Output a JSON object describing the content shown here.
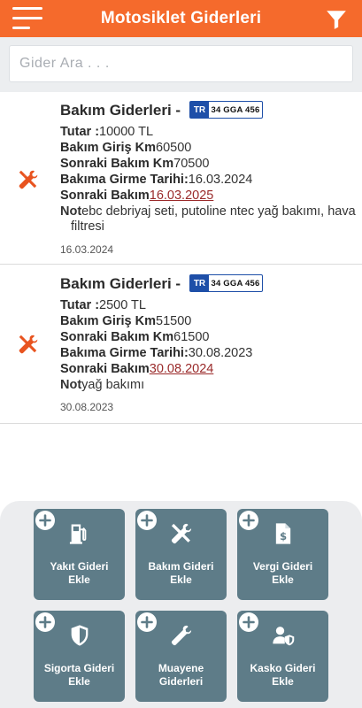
{
  "app": {
    "title": "Motosiklet Giderleri",
    "accent_color": "#f56a2c",
    "menu_icon": "hamburger-menu-icon",
    "filter_icon": "filter-icon"
  },
  "search": {
    "placeholder": "Gider Ara . . ."
  },
  "expenses": [
    {
      "title": "Bakım Giderleri -",
      "icon": "tools-icon",
      "plate": {
        "country": "TR",
        "number": "34 GGA 456"
      },
      "amount_label": "Tutar :",
      "amount": "10000 TL",
      "km_in_label": "Bakım Giriş Km",
      "km_in": "60500",
      "km_next_label": "Sonraki Bakım Km",
      "km_next": "70500",
      "date_in_label": "Bakıma Girme Tarihi:",
      "date_in": "16.03.2024",
      "next_label": "Sonraki Bakım",
      "next_date": "16.03.2025",
      "note_label": "Not",
      "note_line1": "ebc debriyaj seti, putoline ntec yağ bakımı, hava",
      "note_line2": "filtresi",
      "date": "16.03.2024"
    },
    {
      "title": "Bakım Giderleri -",
      "icon": "tools-icon",
      "plate": {
        "country": "TR",
        "number": "34 GGA 456"
      },
      "amount_label": "Tutar :",
      "amount": "2500 TL",
      "km_in_label": "Bakım Giriş Km",
      "km_in": "51500",
      "km_next_label": "Sonraki Bakım Km",
      "km_next": "61500",
      "date_in_label": "Bakıma Girme Tarihi:",
      "date_in": "30.08.2023",
      "next_label": "Sonraki Bakım",
      "next_date": "30.08.2024",
      "note_label": "Not",
      "note_line1": "yağ bakımı",
      "note_line2": "",
      "date": "30.08.2023"
    }
  ],
  "actions": [
    {
      "label": "Yakıt Gideri\nEkle",
      "icon": "fuel-pump-icon"
    },
    {
      "label": "Bakım Gideri\nEkle",
      "icon": "tools-icon"
    },
    {
      "label": "Vergi Gideri\nEkle",
      "icon": "tax-document-icon"
    },
    {
      "label": "Sigorta Gideri\nEkle",
      "icon": "shield-icon"
    },
    {
      "label": "Muayene\nGiderleri",
      "icon": "wrench-icon"
    },
    {
      "label": "Kasko Gideri\nEkle",
      "icon": "user-shield-icon"
    }
  ],
  "colors": {
    "tile": "#5e7c88",
    "panel": "#ecedef",
    "link": "#9a2a2a",
    "plate_blue": "#1e4fa8"
  }
}
